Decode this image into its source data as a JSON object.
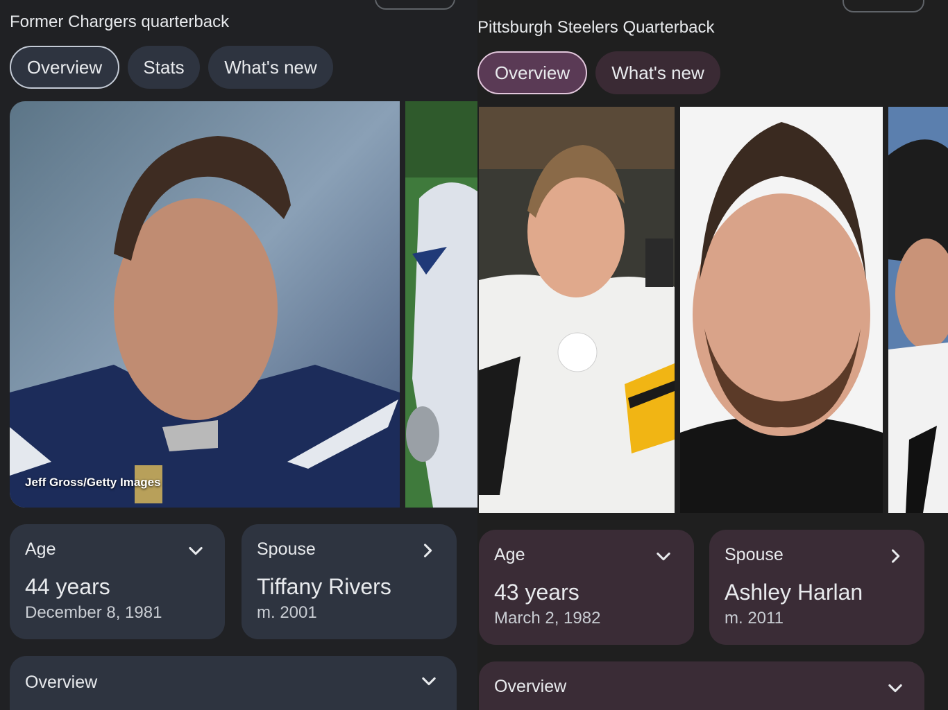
{
  "left": {
    "subtitle": "Former Chargers quarterback",
    "tabs": [
      {
        "label": "Overview",
        "active": true
      },
      {
        "label": "Stats",
        "active": false
      },
      {
        "label": "What's new",
        "active": false
      }
    ],
    "photo_credit": "Jeff Gross/Getty Images",
    "age_card": {
      "label": "Age",
      "value": "44 years",
      "sub": "December 8, 1981"
    },
    "spouse_card": {
      "label": "Spouse",
      "value": "Tiffany Rivers",
      "sub": "m. 2001"
    },
    "overview_card": {
      "label": "Overview"
    }
  },
  "right": {
    "subtitle": "Pittsburgh Steelers Quarterback",
    "tabs": [
      {
        "label": "Overview",
        "active": true
      },
      {
        "label": "What's new",
        "active": false
      }
    ],
    "age_card": {
      "label": "Age",
      "value": "43 years",
      "sub": "March 2, 1982"
    },
    "spouse_card": {
      "label": "Spouse",
      "value": "Ashley Harlan",
      "sub": "m. 2011"
    },
    "overview_card": {
      "label": "Overview"
    }
  },
  "colors": {
    "left_surface": "#2e3440",
    "right_surface": "#3a2c36",
    "right_active_tab": "#5a3a55"
  },
  "icons": {
    "expand": "chevron-down-icon",
    "navigate": "chevron-right-icon"
  }
}
